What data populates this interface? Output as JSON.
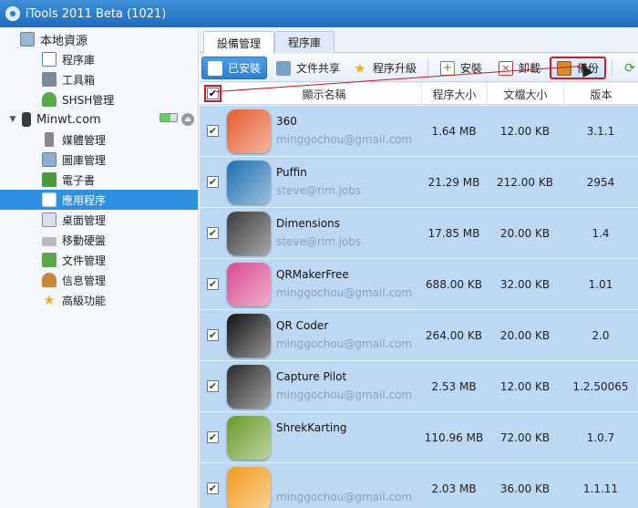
{
  "window": {
    "title": "iTools 2011 Beta (1021)"
  },
  "sidebar": {
    "local_root": "本地資源",
    "local_items": [
      {
        "label": "程序庫",
        "icon": "window-icon"
      },
      {
        "label": "工具箱",
        "icon": "toolbox-icon"
      },
      {
        "label": "SHSH管理",
        "icon": "umbrella-icon"
      }
    ],
    "device_root": "Minwt.com",
    "device_items": [
      {
        "label": "媒體管理",
        "icon": "media-icon"
      },
      {
        "label": "圖庫管理",
        "icon": "gallery-icon"
      },
      {
        "label": "電子書",
        "icon": "ebook-icon"
      },
      {
        "label": "應用程序",
        "icon": "apps-icon"
      },
      {
        "label": "桌面管理",
        "icon": "desktop-icon"
      },
      {
        "label": "移動硬盤",
        "icon": "disk-icon"
      },
      {
        "label": "文件管理",
        "icon": "folder-icon"
      },
      {
        "label": "信息管理",
        "icon": "contacts-icon"
      },
      {
        "label": "高級功能",
        "icon": "star-icon"
      }
    ],
    "selected": "應用程序"
  },
  "tabs": [
    "設備管理",
    "程序庫"
  ],
  "toolbar": {
    "installed": "已安裝",
    "file_share": "文件共享",
    "upgrade": "程序升級",
    "install": "安裝",
    "uninstall": "卸載",
    "backup": "備份"
  },
  "columns": {
    "name": "顯示名稱",
    "app_size": "程序大小",
    "doc_size": "文檔大小",
    "version": "版本"
  },
  "apps": [
    {
      "name": "360",
      "email": "minggochou@gmail.com",
      "app_size": "1.64 MB",
      "doc_size": "12.00 KB",
      "version": "3.1.1",
      "color": "#e55a2b"
    },
    {
      "name": "Puffin",
      "email": "steve@rim.jobs",
      "app_size": "21.29 MB",
      "doc_size": "212.00 KB",
      "version": "2954",
      "color": "#1f6fb0"
    },
    {
      "name": "Dimensions",
      "email": "steve@rim.jobs",
      "app_size": "17.85 MB",
      "doc_size": "20.00 KB",
      "version": "1.4",
      "color": "#3b3b3b"
    },
    {
      "name": "QRMakerFree",
      "email": "minggochou@gmail.com",
      "app_size": "688.00 KB",
      "doc_size": "32.00 KB",
      "version": "1.01",
      "color": "#d94a8f"
    },
    {
      "name": "QR Coder",
      "email": "minggochou@gmail.com",
      "app_size": "264.00 KB",
      "doc_size": "20.00 KB",
      "version": "2.0",
      "color": "#111111"
    },
    {
      "name": "Capture Pilot",
      "email": "minggochou@gmail.com",
      "app_size": "2.53 MB",
      "doc_size": "12.00 KB",
      "version": "1.2.50065",
      "color": "#2a2a2a"
    },
    {
      "name": "ShrekKarting",
      "email": "",
      "app_size": "110.96 MB",
      "doc_size": "72.00 KB",
      "version": "1.0.7",
      "color": "#6a9a2a"
    },
    {
      "name": "",
      "email": "minggochou@gmail.com",
      "app_size": "2.03 MB",
      "doc_size": "36.00 KB",
      "version": "1.1.11",
      "color": "#f39a1a"
    }
  ]
}
